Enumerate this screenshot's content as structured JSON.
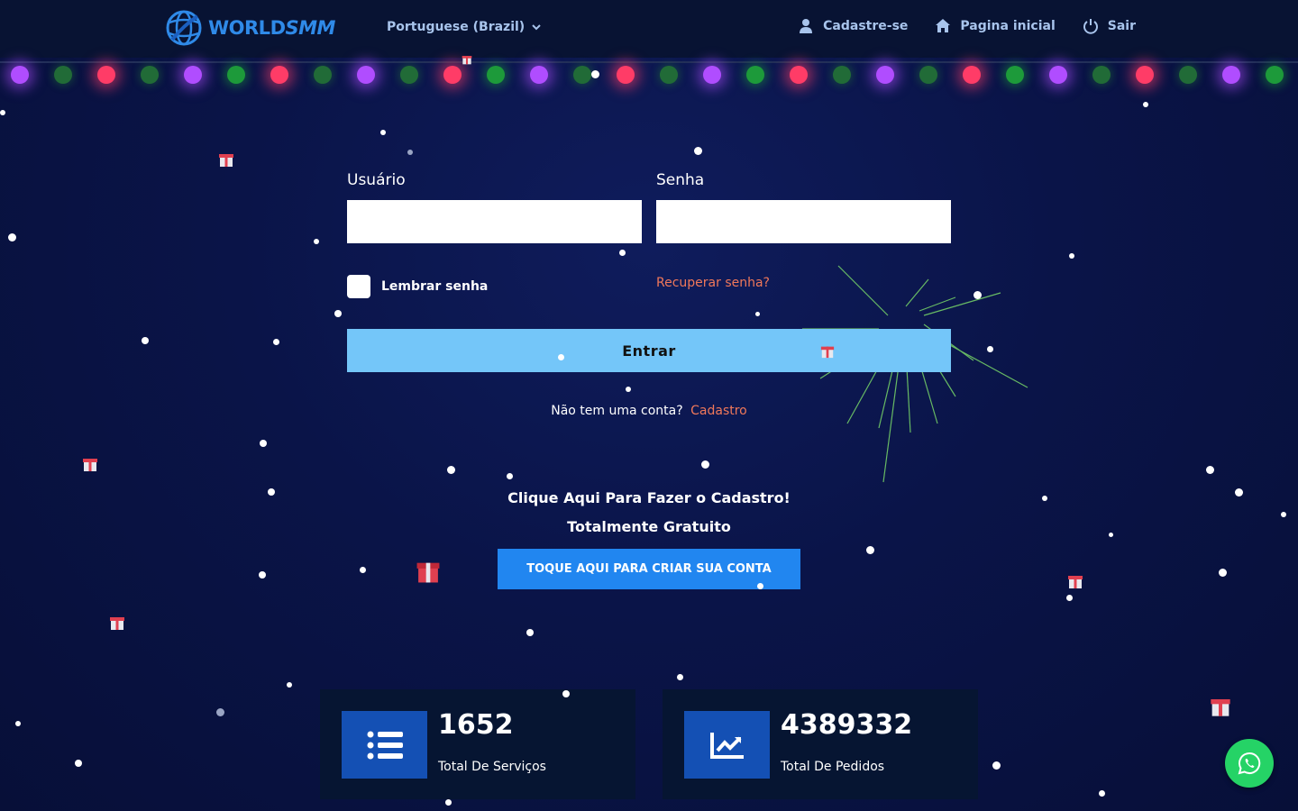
{
  "navbar": {
    "brand_world": "WORLD",
    "brand_smm": "SMM",
    "language": "Portuguese (Brazil)",
    "links": [
      {
        "label": "Cadastre-se",
        "icon": "user-icon"
      },
      {
        "label": "Pagina inicial",
        "icon": "home-icon"
      },
      {
        "label": "Sair",
        "icon": "power-icon"
      }
    ]
  },
  "login": {
    "username_label": "Usuário",
    "password_label": "Senha",
    "remember_label": "Lembrar senha",
    "recover_label": "Recuperar senha?",
    "submit_label": "Entrar",
    "no_account_text": "Não tem uma conta?",
    "signup_link": "Cadastro"
  },
  "promo": {
    "line1": "Clique Aqui Para Fazer o Cadastro!",
    "line2": "Totalmente Gratuito",
    "cta_label": "TOQUE AQUI PARA CRIAR SUA CONTA"
  },
  "stats": [
    {
      "value": "1652",
      "label": "Total De Serviços",
      "icon": "list-icon"
    },
    {
      "value": "4389332",
      "label": "Total De Pedidos",
      "icon": "chart-line-icon"
    }
  ],
  "colors": {
    "accent": "#2186f0",
    "login_button": "#74c6f9",
    "link": "#f0785a",
    "whatsapp": "#25d366"
  }
}
